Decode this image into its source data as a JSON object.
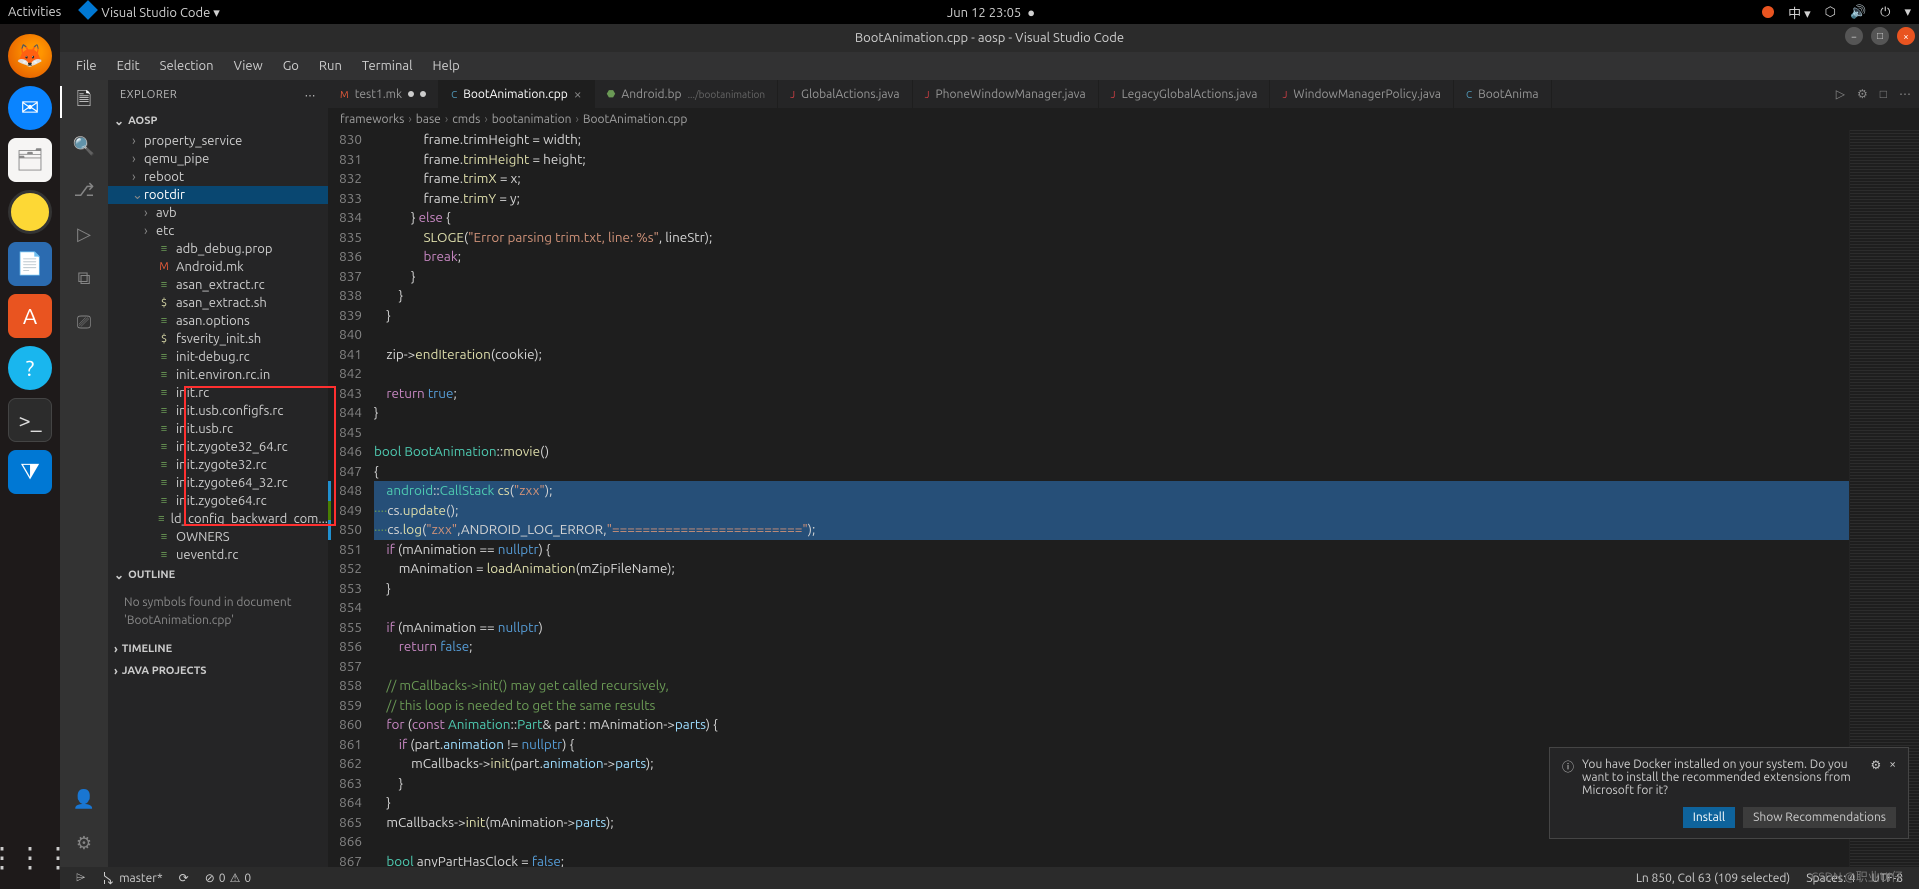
{
  "gnome": {
    "activities": "Activities",
    "app": "Visual Studio Code ▾",
    "clock": "Jun 12  23:05",
    "tray_lang": "中 ▾"
  },
  "title": "BootAnimation.cpp - aosp - Visual Studio Code",
  "menubar": [
    "File",
    "Edit",
    "Selection",
    "View",
    "Go",
    "Run",
    "Terminal",
    "Help"
  ],
  "explorer": {
    "title": "EXPLORER",
    "root": "AOSP",
    "outline_title": "OUTLINE",
    "outline_empty": "No symbols found in document 'BootAnimation.cpp'",
    "timeline": "TIMELINE",
    "java_projects": "JAVA PROJECTS",
    "tree": [
      {
        "name": "property_service",
        "type": "folder",
        "indent": 1
      },
      {
        "name": "qemu_pipe",
        "type": "folder",
        "indent": 1
      },
      {
        "name": "reboot",
        "type": "folder",
        "indent": 1
      },
      {
        "name": "rootdir",
        "type": "folder",
        "indent": 1,
        "open": true,
        "selected": true
      },
      {
        "name": "avb",
        "type": "folder",
        "indent": 2
      },
      {
        "name": "etc",
        "type": "folder",
        "indent": 2
      },
      {
        "name": "adb_debug.prop",
        "type": "file",
        "icon": "rc",
        "indent": 2
      },
      {
        "name": "Android.mk",
        "type": "file",
        "icon": "mk",
        "indent": 2
      },
      {
        "name": "asan_extract.rc",
        "type": "file",
        "icon": "rc",
        "indent": 2
      },
      {
        "name": "asan_extract.sh",
        "type": "file",
        "icon": "sh",
        "indent": 2
      },
      {
        "name": "asan.options",
        "type": "file",
        "icon": "rc",
        "indent": 2
      },
      {
        "name": "fsverity_init.sh",
        "type": "file",
        "icon": "sh",
        "indent": 2
      },
      {
        "name": "init-debug.rc",
        "type": "file",
        "icon": "rc",
        "indent": 2
      },
      {
        "name": "init.environ.rc.in",
        "type": "file",
        "icon": "rc",
        "indent": 2
      },
      {
        "name": "init.rc",
        "type": "file",
        "icon": "rc",
        "indent": 2
      },
      {
        "name": "init.usb.configfs.rc",
        "type": "file",
        "icon": "rc",
        "indent": 2
      },
      {
        "name": "init.usb.rc",
        "type": "file",
        "icon": "rc",
        "indent": 2
      },
      {
        "name": "init.zygote32_64.rc",
        "type": "file",
        "icon": "rc",
        "indent": 2
      },
      {
        "name": "init.zygote32.rc",
        "type": "file",
        "icon": "rc",
        "indent": 2
      },
      {
        "name": "init.zygote64_32.rc",
        "type": "file",
        "icon": "rc",
        "indent": 2
      },
      {
        "name": "init.zygote64.rc",
        "type": "file",
        "icon": "rc",
        "indent": 2
      },
      {
        "name": "ld_config_backward_com...",
        "type": "file",
        "icon": "rc",
        "indent": 2
      },
      {
        "name": "OWNERS",
        "type": "file",
        "icon": "rc",
        "indent": 2
      },
      {
        "name": "ueventd.rc",
        "type": "file",
        "icon": "rc",
        "indent": 2
      }
    ]
  },
  "tabs": [
    {
      "name": "test1.mk",
      "icon": "M",
      "color": "#e85b3a",
      "mod": true
    },
    {
      "name": "BootAnimation.cpp",
      "icon": "C",
      "color": "#519aba",
      "active": true,
      "mod": true,
      "close": true
    },
    {
      "name": "Android.bp",
      "icon": "⬣",
      "color": "#6a9955",
      "sub": ".../bootanimation"
    },
    {
      "name": "GlobalActions.java",
      "icon": "J",
      "color": "#cc3e44"
    },
    {
      "name": "PhoneWindowManager.java",
      "icon": "J",
      "color": "#cc3e44"
    },
    {
      "name": "LegacyGlobalActions.java",
      "icon": "J",
      "color": "#cc3e44"
    },
    {
      "name": "WindowManagerPolicy.java",
      "icon": "J",
      "color": "#cc3e44"
    },
    {
      "name": "BootAnima",
      "icon": "C",
      "color": "#519aba"
    }
  ],
  "breadcrumb": [
    "frameworks",
    "base",
    "cmds",
    "bootanimation",
    "BootAnimation.cpp"
  ],
  "code_start": 830,
  "code": [
    {
      "t": "                frame.trimHeight = width;"
    },
    {
      "t": "                frame.<fn>trimHeight</fn> = height;"
    },
    {
      "t": "                frame.<fn>trimX</fn> = x;"
    },
    {
      "t": "                frame.<fn>trimY</fn> = y;"
    },
    {
      "t": "            } <kw>else</kw> {"
    },
    {
      "t": "                <fn>SLOGE</fn>(<str>\"Error parsing trim.txt, line: %s\"</str>, lineStr);"
    },
    {
      "t": "                <kw>break</kw>;"
    },
    {
      "t": "            }"
    },
    {
      "t": "        }"
    },
    {
      "t": "    }"
    },
    {
      "t": ""
    },
    {
      "t": "    zip-><fn>endIteration</fn>(cookie);"
    },
    {
      "t": ""
    },
    {
      "t": "    <kw>return</kw> <const>true</const>;"
    },
    {
      "t": "}"
    },
    {
      "t": ""
    },
    {
      "t": "<ty>bool</ty> <ty>BootAnimation</ty>::<fn>movie</fn>()"
    },
    {
      "t": "{"
    },
    {
      "t": "    <ty>android</ty>::<ty>CallStack</ty> <fn>cs</fn>(<str>\"zxx\"</str>);",
      "sel": true,
      "mod": true
    },
    {
      "t": "<cmt>····</cmt>cs.<fn>update</fn>();",
      "sel": true,
      "add": true
    },
    {
      "t": "<cmt>····</cmt>cs.<fn>log</fn>(<str>\"zxx\"</str>,ANDROID_LOG_ERROR,<str>\"=========================\"</str>);",
      "sel": true,
      "mod": true
    },
    {
      "t": "    <kw>if</kw> (mAnimation == <const>nullptr</const>) {"
    },
    {
      "t": "        mAnimation = <fn>loadAnimation</fn>(mZipFileName);"
    },
    {
      "t": "    }"
    },
    {
      "t": ""
    },
    {
      "t": "    <kw>if</kw> (mAnimation == <const>nullptr</const>)"
    },
    {
      "t": "        <kw>return</kw> <const>false</const>;"
    },
    {
      "t": ""
    },
    {
      "t": "    <cmt>// mCallbacks->init() may get called recursively,</cmt>"
    },
    {
      "t": "    <cmt>// this loop is needed to get the same results</cmt>"
    },
    {
      "t": "    <kw>for</kw> (<kw>const</kw> <ty>Animation</ty>::<ty>Part</ty>& part : mAnimation-><var>parts</var>) {"
    },
    {
      "t": "        <kw>if</kw> (part.<var>animation</var> != <const>nullptr</const>) {"
    },
    {
      "t": "            mCallbacks-><fn>init</fn>(part.<var>animation</var>-><var>parts</var>);"
    },
    {
      "t": "        }"
    },
    {
      "t": "    }"
    },
    {
      "t": "    mCallbacks-><fn>init</fn>(mAnimation-><var>parts</var>);"
    },
    {
      "t": ""
    },
    {
      "t": "    <ty>bool</ty> anyPartHasClock = <const>false</const>;"
    }
  ],
  "notif": {
    "text": "You have Docker installed on your system. Do you want to install the recommended extensions from Microsoft for it?",
    "install": "Install",
    "show": "Show Recommendations"
  },
  "status": {
    "branch": "master*",
    "sync": "⟳",
    "errors": "0",
    "warnings": "0",
    "cursor": "Ln 850, Col 63 (109 selected)",
    "spaces": "Spaces: 4",
    "encoding": "UTF-8"
  },
  "watermark": "CSDN @职业UI仔"
}
